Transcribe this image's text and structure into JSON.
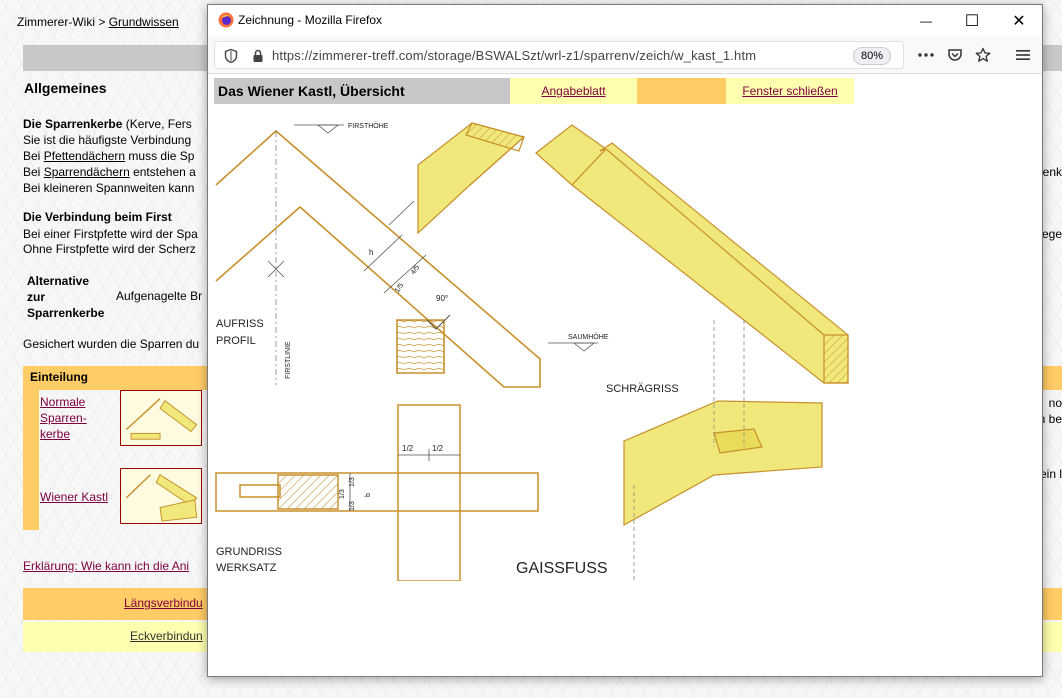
{
  "background_page": {
    "breadcrumb_root": "Zimmerer-Wiki",
    "breadcrumb_sep": ">",
    "breadcrumb_current": "Grundwissen",
    "heading": "Allgemeines",
    "sparrenkerbe_bold": "Die Sparrenkerbe",
    "sparrenkerbe_rest": " (Kerve, Fers",
    "line_haeufigste": "Sie ist die häufigste Verbindung",
    "line_pfetten_pre": "Bei ",
    "line_pfetten_link": "Pfettendächern",
    "line_pfetten_post": " muss die Sp",
    "line_sparren_pre": "Bei ",
    "line_sparren_link": "Sparrendächern",
    "line_sparren_post": " entstehen a",
    "line_sparren_right": "renk",
    "line_kleineren": "Bei kleineren Spannweiten kann",
    "verbindung_heading": "Die Verbindung beim First",
    "line_firstpfette": "Bei einer Firstpfette wird der Spa",
    "line_firstpfette_right": "rege",
    "line_ohne": "Ohne Firstpfette wird der Scherz",
    "alternative_1": "Alternative",
    "alternative_2": "zur",
    "alternative_3": "Sparrenkerbe",
    "alternative_text": "Aufgenagelte Br",
    "line_gesichert": "Gesichert wurden die Sparren du",
    "einteilung": "Einteilung",
    "item1_line1": "Normale",
    "item1_line2": "Sparren-",
    "item1_line3": "kerbe",
    "item2": "Wiener Kastl",
    "right_no": "no",
    "right_be": "n be",
    "right_ein": "ein l",
    "erklaerung_link": "Erklärung: Wie kann ich die Ani",
    "nav1_link": "Längsverbindu",
    "nav2_link": "Eckverbindun"
  },
  "popup_window": {
    "title": "Zeichnung - Mozilla Firefox",
    "controls": {
      "minimize": "—",
      "maximize": "☐",
      "close": "✕"
    },
    "url": "https://zimmerer-treff.com/storage/BSWALSzt/wrl-z1/sparrenv/zeich/w_kast_1.htm",
    "zoom": "80%",
    "toolbar_icons": [
      "more-icon",
      "pocket-icon",
      "bookmark-star-icon",
      "menu-icon"
    ],
    "brand_color": "#ff7139"
  },
  "popup_content": {
    "header_title": "Das Wiener Kastl, Übersicht",
    "link_angabeblatt": "Angabeblatt",
    "link_fenster": "Fenster schließen",
    "colors": {
      "header_gray": "#c8c8c8",
      "light_yellow": "#ffffb0",
      "orange": "#ffcc66",
      "line_brown": "#c8902c",
      "timber_yellow": "#f0e87a"
    }
  },
  "drawing": {
    "label_firsthoehe": "FIRSTHÖHE",
    "label_aufriss": "AUFRISS",
    "label_profil": "PROFIL",
    "label_firstlinie": "FIRSTLINIE",
    "label_90": "90°",
    "label_h": "h",
    "label_15": "1/5",
    "label_45": "4/5",
    "label_saumhoehe": "SAUMHÖHE",
    "label_schraegriss": "SCHRÄGRISS",
    "label_grundriss": "GRUNDRISS",
    "label_werksatz": "WERKSATZ",
    "label_12a": "1/2",
    "label_12b": "1/2",
    "label_13a": "1/3",
    "label_13b": "1/3",
    "label_13c": "1/3",
    "label_b": "b",
    "label_gaissfuss": "GAISSFUSS"
  }
}
